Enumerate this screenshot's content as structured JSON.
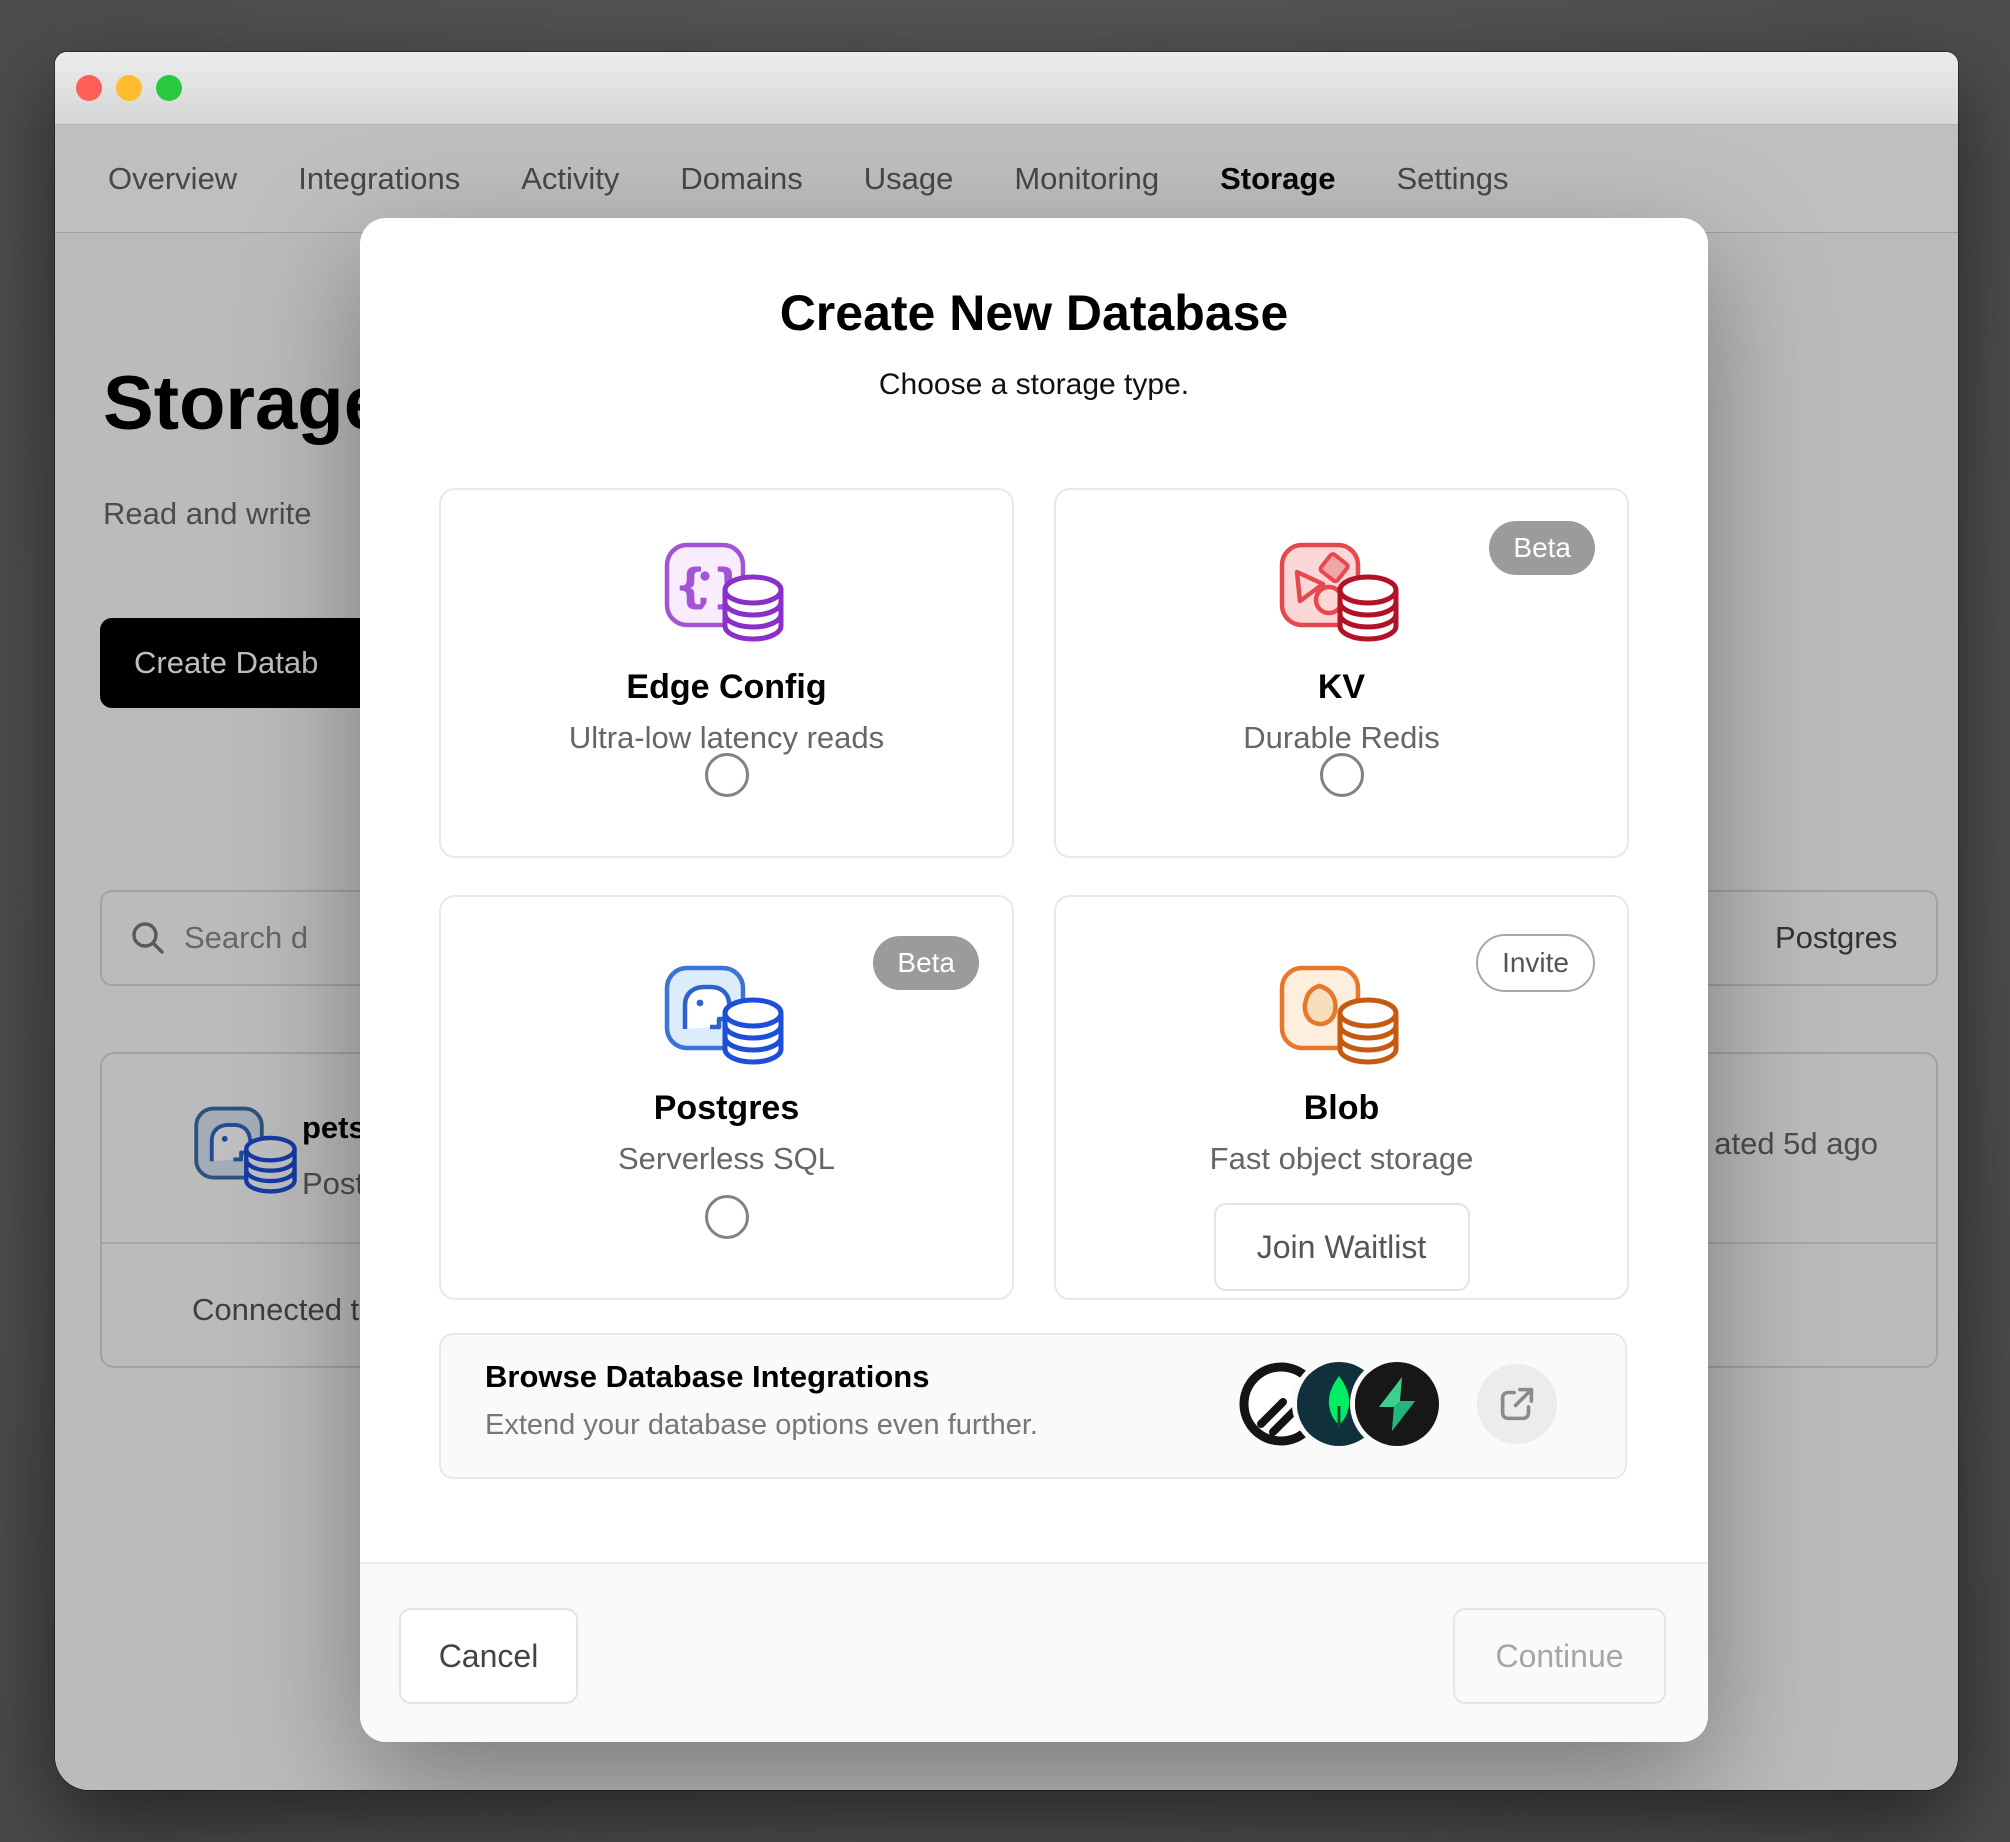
{
  "titlebar": {
    "close": "close-light",
    "minimize": "minimize-light",
    "zoom": "zoom-light"
  },
  "nav": {
    "items": [
      {
        "label": "Overview",
        "active": false
      },
      {
        "label": "Integrations",
        "active": false
      },
      {
        "label": "Activity",
        "active": false
      },
      {
        "label": "Domains",
        "active": false
      },
      {
        "label": "Usage",
        "active": false
      },
      {
        "label": "Monitoring",
        "active": false
      },
      {
        "label": "Storage",
        "active": true
      },
      {
        "label": "Settings",
        "active": false
      }
    ]
  },
  "page": {
    "heading": "Storage",
    "subheading_visible": "Read and write",
    "create_button_visible": "Create Datab",
    "search_placeholder_visible": "Search d",
    "filter_value": "Postgres",
    "list_item": {
      "name_visible": "petsto",
      "type_visible": "Postg",
      "updated_visible": "ated 5d ago",
      "connected_visible": "Connected to"
    }
  },
  "modal": {
    "title": "Create New Database",
    "subtitle": "Choose a storage type.",
    "cards": [
      {
        "name": "Edge Config",
        "description": "Ultra-low latency reads",
        "badge": "",
        "icon": "edge-config-icon",
        "accent": "#a254d4"
      },
      {
        "name": "KV",
        "description": "Durable Redis",
        "badge": "Beta",
        "icon": "kv-redis-icon",
        "accent": "#e5484d"
      },
      {
        "name": "Postgres",
        "description": "Serverless SQL",
        "badge": "Beta",
        "icon": "postgres-icon",
        "accent": "#2e64c7"
      },
      {
        "name": "Blob",
        "description": "Fast object storage",
        "badge": "Invite",
        "icon": "blob-icon",
        "accent": "#e8772e",
        "action_label": "Join Waitlist"
      }
    ],
    "integrations": {
      "title": "Browse Database Integrations",
      "subtitle": "Extend your database options even further.",
      "logos": [
        "planetscale-logo",
        "mongodb-logo",
        "supabase-logo"
      ],
      "logo_colors": {
        "planetscale": "#141414",
        "mongodb_bg": "#10303c",
        "mongodb_leaf": "#00ed64",
        "supabase_bg": "#171717",
        "supabase_bolt": "#3ecf8e"
      }
    },
    "footer": {
      "cancel": "Cancel",
      "continue": "Continue"
    }
  },
  "colors": {
    "traffic_red": "#ff5f57",
    "traffic_yellow": "#febc2e",
    "traffic_green": "#28c840",
    "badge_solid_bg": "#9b9b9b",
    "modal_bg": "#ffffff",
    "footer_bg": "#fafafa"
  }
}
